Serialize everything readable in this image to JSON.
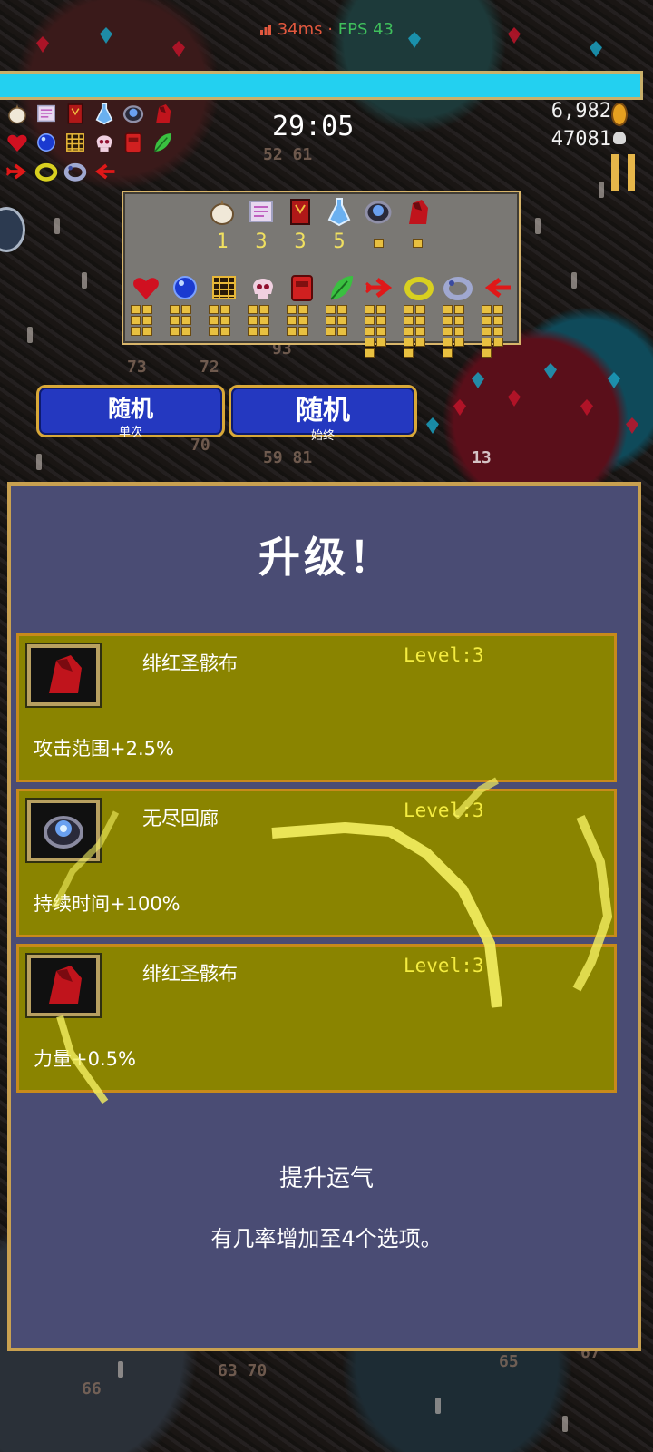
{
  "status": {
    "ping": "34ms",
    "separator": " · ",
    "fps": "FPS 43"
  },
  "hud": {
    "timer": "29:05",
    "gold": "6,982",
    "kills": "47081",
    "hud_icons": [
      "garlic-icon",
      "scroll-icon",
      "tome-icon",
      "bottle-icon",
      "eye-ring-icon",
      "crimson-shroud-icon",
      "heart-icon",
      "orb-icon",
      "grate-icon",
      "skull-icon",
      "red-tome-icon",
      "leaf-icon",
      "red-arrow-icon",
      "gold-ring-icon",
      "silver-ring-icon",
      "red-arrow-left-icon"
    ]
  },
  "inventory": {
    "weapons": [
      {
        "icon": "garlic-icon",
        "level": "1"
      },
      {
        "icon": "scroll-icon",
        "level": "3"
      },
      {
        "icon": "tome-icon",
        "level": "3"
      },
      {
        "icon": "bottle-icon",
        "level": "5"
      },
      {
        "icon": "eye-ring-icon",
        "level": ""
      },
      {
        "icon": "crimson-shroud-icon",
        "level": ""
      }
    ],
    "passives": [
      {
        "icon": "heart-icon",
        "pips": 6
      },
      {
        "icon": "orb-icon",
        "pips": 6
      },
      {
        "icon": "grate-icon",
        "pips": 6
      },
      {
        "icon": "skull-icon",
        "pips": 6
      },
      {
        "icon": "red-tome-icon",
        "pips": 6
      },
      {
        "icon": "leaf-icon",
        "pips": 6
      },
      {
        "icon": "red-arrow-icon",
        "pips": 9
      },
      {
        "icon": "gold-ring-icon",
        "pips": 9
      },
      {
        "icon": "silver-ring-icon",
        "pips": 9
      },
      {
        "icon": "red-arrow-left-icon",
        "pips": 9
      }
    ]
  },
  "random_buttons": [
    {
      "title": "随机",
      "subtitle": "单次"
    },
    {
      "title": "随机",
      "subtitle": "始终"
    }
  ],
  "levelup": {
    "title": "升级！",
    "options": [
      {
        "name": "绯红圣骸布",
        "level": "Level:3",
        "desc": "攻击范围+2.5%",
        "icon": "crimson-shroud-icon"
      },
      {
        "name": "无尽回廊",
        "level": "Level:3",
        "desc": "持续时间+100%",
        "icon": "eye-ring-icon"
      },
      {
        "name": "绯红圣骸布",
        "level": "Level:3",
        "desc": "力量+0.5%",
        "icon": "crimson-shroud-icon"
      }
    ],
    "luck_title": "提升运气",
    "luck_desc": "有几率增加至4个选项。"
  },
  "colors": {
    "xp": "#23d0f0",
    "panel": "#4a4c74",
    "card": "#8a8400",
    "border": "#c8a050",
    "level_text": "#f4ec40"
  }
}
